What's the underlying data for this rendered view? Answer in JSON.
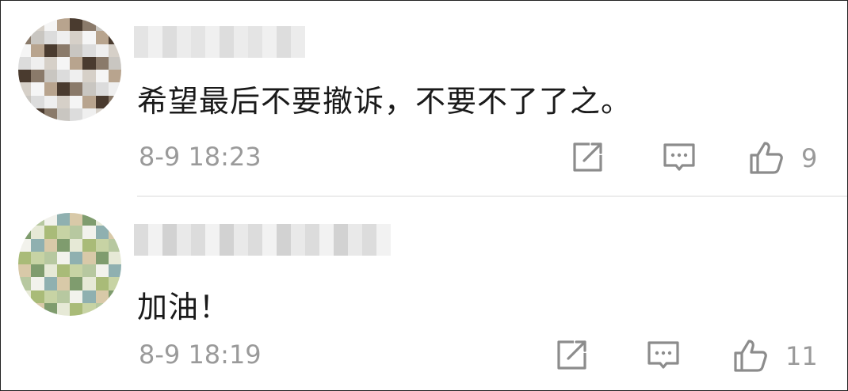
{
  "comments": [
    {
      "text": "希望最后不要撤诉，不要不了了之。",
      "time": "8-9 18:23",
      "likes": "9",
      "avatar_palette": [
        "#efefef",
        "#dcdcdc",
        "#c9c6c1",
        "#8a7a6a",
        "#4a3b2f",
        "#b8a48e",
        "#f5f5f5",
        "#d6d0c8"
      ],
      "username_palette": [
        "#ececec",
        "#e4e4e4",
        "#f0f0f0",
        "#dddddd"
      ]
    },
    {
      "text": "加油！",
      "time": "8-9 18:19",
      "likes": "11",
      "avatar_palette": [
        "#c7d3a4",
        "#a9bb78",
        "#e6e9d6",
        "#7f9c6e",
        "#d8c9a8",
        "#8fb0b0",
        "#f2f2ec",
        "#b7c8a0"
      ],
      "username_palette": [
        "#e9e9e9",
        "#dcdcdc",
        "#f2f2f2",
        "#d2d2d2"
      ]
    }
  ],
  "icons": {
    "share": "share-icon",
    "reply": "comment-icon",
    "like": "thumbs-up-icon"
  },
  "colors": {
    "text": "#1a1a1a",
    "meta": "#9a9a9a",
    "icon": "#8c8c8c",
    "divider": "#ececec"
  }
}
